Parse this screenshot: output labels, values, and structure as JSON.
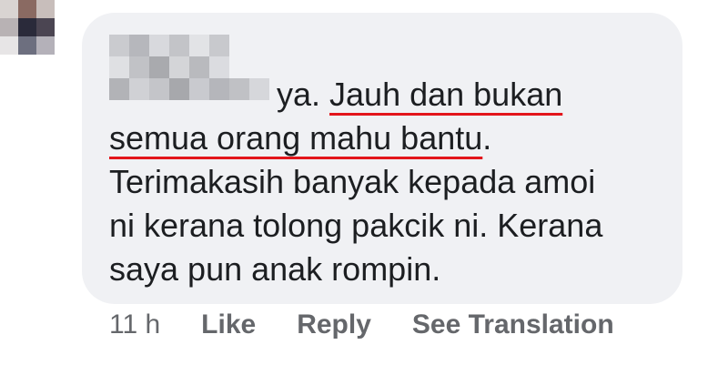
{
  "comment": {
    "author_blurred": true,
    "text_line1_plain": "ya. ",
    "text_line1_underlined": "Jauh dan bukan",
    "text_line2_underlined": "semua orang mahu bantu",
    "text_line2_plain": ".",
    "text_line3": "Terimakasih banyak kepada amoi",
    "text_line4": "ni kerana tolong pakcik ni. Kerana",
    "text_line5": "saya pun anak rompin.",
    "underline_color": "#e3151b"
  },
  "actions": {
    "timestamp": "11 h",
    "like_label": "Like",
    "reply_label": "Reply",
    "translation_label": "See Translation"
  },
  "colors": {
    "bubble_background": "#f0f1f4",
    "text": "#1c1e21",
    "meta_text": "#65676b"
  }
}
